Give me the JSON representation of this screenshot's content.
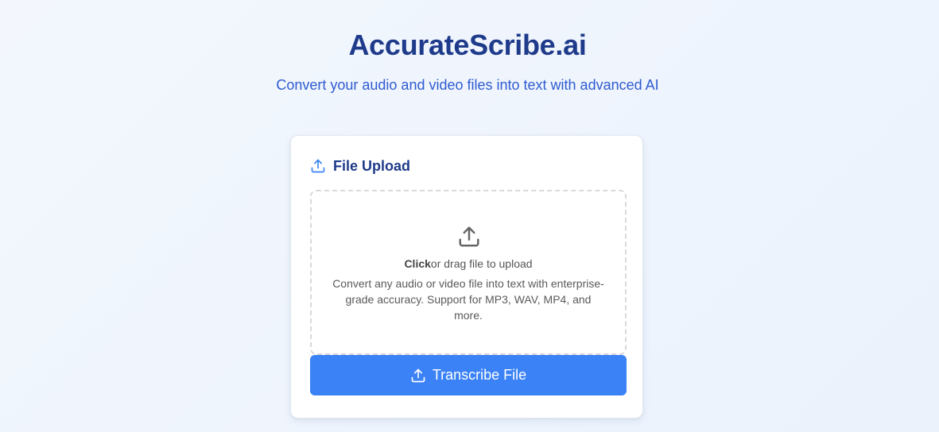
{
  "header": {
    "title": "AccurateScribe.ai",
    "subtitle": "Convert your audio and video files into text with advanced AI"
  },
  "upload_card": {
    "title": "File Upload",
    "title_icon": "upload-icon",
    "dropzone": {
      "icon": "upload-icon",
      "click_text": "Click",
      "action_text": "or drag file to upload",
      "hint": "Convert any audio or video file into text with enterprise-grade accuracy. Support for MP3, WAV, MP4, and more."
    },
    "button": {
      "label": "Transcribe File",
      "icon": "upload-icon"
    }
  },
  "colors": {
    "title": "#1e3a8a",
    "subtitle": "#2f5bd0",
    "accent": "#3b82f6"
  }
}
